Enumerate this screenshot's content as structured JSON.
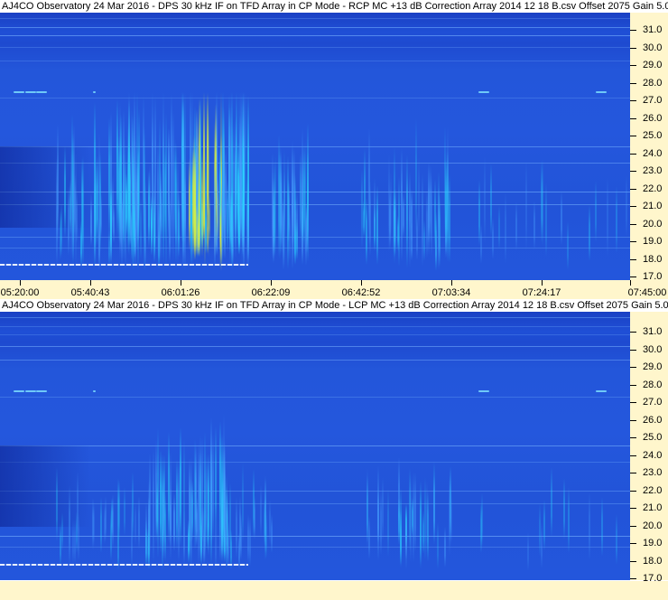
{
  "rcp": {
    "title": "AJ4CO Observatory 24 Mar 2016 - DPS 30 kHz IF on TFD Array in CP Mode - RCP  MC +13 dB  Correction Array 2014 12 18 B.csv  Offset 2075  Gain 5.0",
    "freq_labels": [
      "31.0",
      "30.0",
      "29.0",
      "28.0",
      "27.0",
      "26.0",
      "25.0",
      "24.0",
      "23.0",
      "22.0",
      "21.0",
      "20.0",
      "19.0",
      "18.0",
      "17.0"
    ]
  },
  "time_axis": {
    "labels": [
      "05:20:00",
      "05:40:43",
      "06:01:26",
      "06:22:09",
      "06:42:52",
      "07:03:34",
      "07:24:17",
      "07:45:00"
    ]
  },
  "lcp": {
    "title": "AJ4CO Observatory 24 Mar 2016 - DPS 30 kHz IF on TFD Array in CP Mode - LCP  MC +13 dB  Correction Array 2014 12 18 B.csv  Offset 2075  Gain 5.0",
    "freq_labels": [
      "31.0",
      "30.0",
      "29.0",
      "28.0",
      "27.0",
      "26.0",
      "25.0",
      "24.0",
      "23.0",
      "22.0",
      "21.0",
      "20.0",
      "19.0",
      "18.0",
      "17.0"
    ]
  },
  "colors": {
    "background_blue": "#2356da",
    "axis_bg": "#fff6cc",
    "burst_cyan": "#29d4ff",
    "burst_yellow": "#d8f040"
  }
}
